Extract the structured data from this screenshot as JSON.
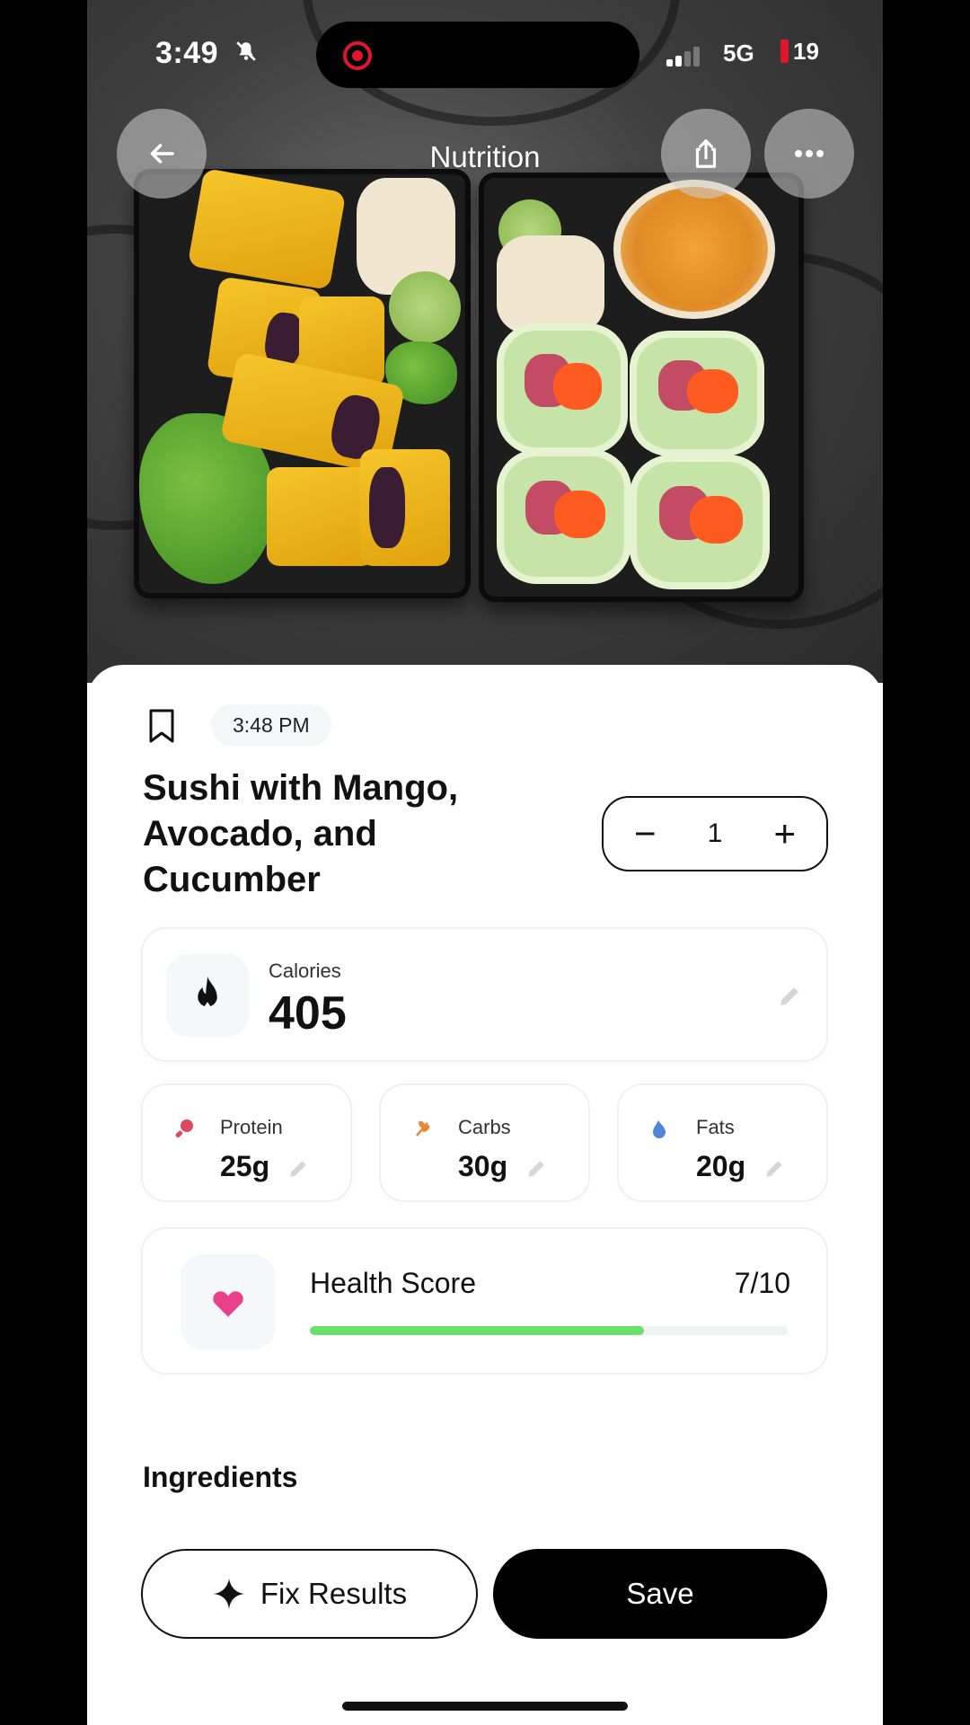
{
  "status_bar": {
    "time": "3:49",
    "network": "5G",
    "battery": "19"
  },
  "nav": {
    "title": "Nutrition",
    "icons": [
      "back-arrow-icon",
      "share-icon",
      "more-icon"
    ]
  },
  "entry": {
    "time": "3:48 PM",
    "title": "Sushi with Mango, Avocado, and Cucumber",
    "quantity": "1",
    "minus": "−",
    "plus": "+"
  },
  "calories": {
    "label": "Calories",
    "value": "405"
  },
  "macros": [
    {
      "label": "Protein",
      "value": "25g",
      "color": "#e0475f"
    },
    {
      "label": "Carbs",
      "value": "30g",
      "color": "#e8893a"
    },
    {
      "label": "Fats",
      "value": "20g",
      "color": "#4f86d9"
    }
  ],
  "health": {
    "label": "Health Score",
    "score": "7/10",
    "progress": 0.7,
    "bar_color": "#6be06b",
    "icon_color": "#e8408a"
  },
  "sections": {
    "ingredients": "Ingredients"
  },
  "actions": {
    "fix": "Fix Results",
    "save": "Save"
  }
}
